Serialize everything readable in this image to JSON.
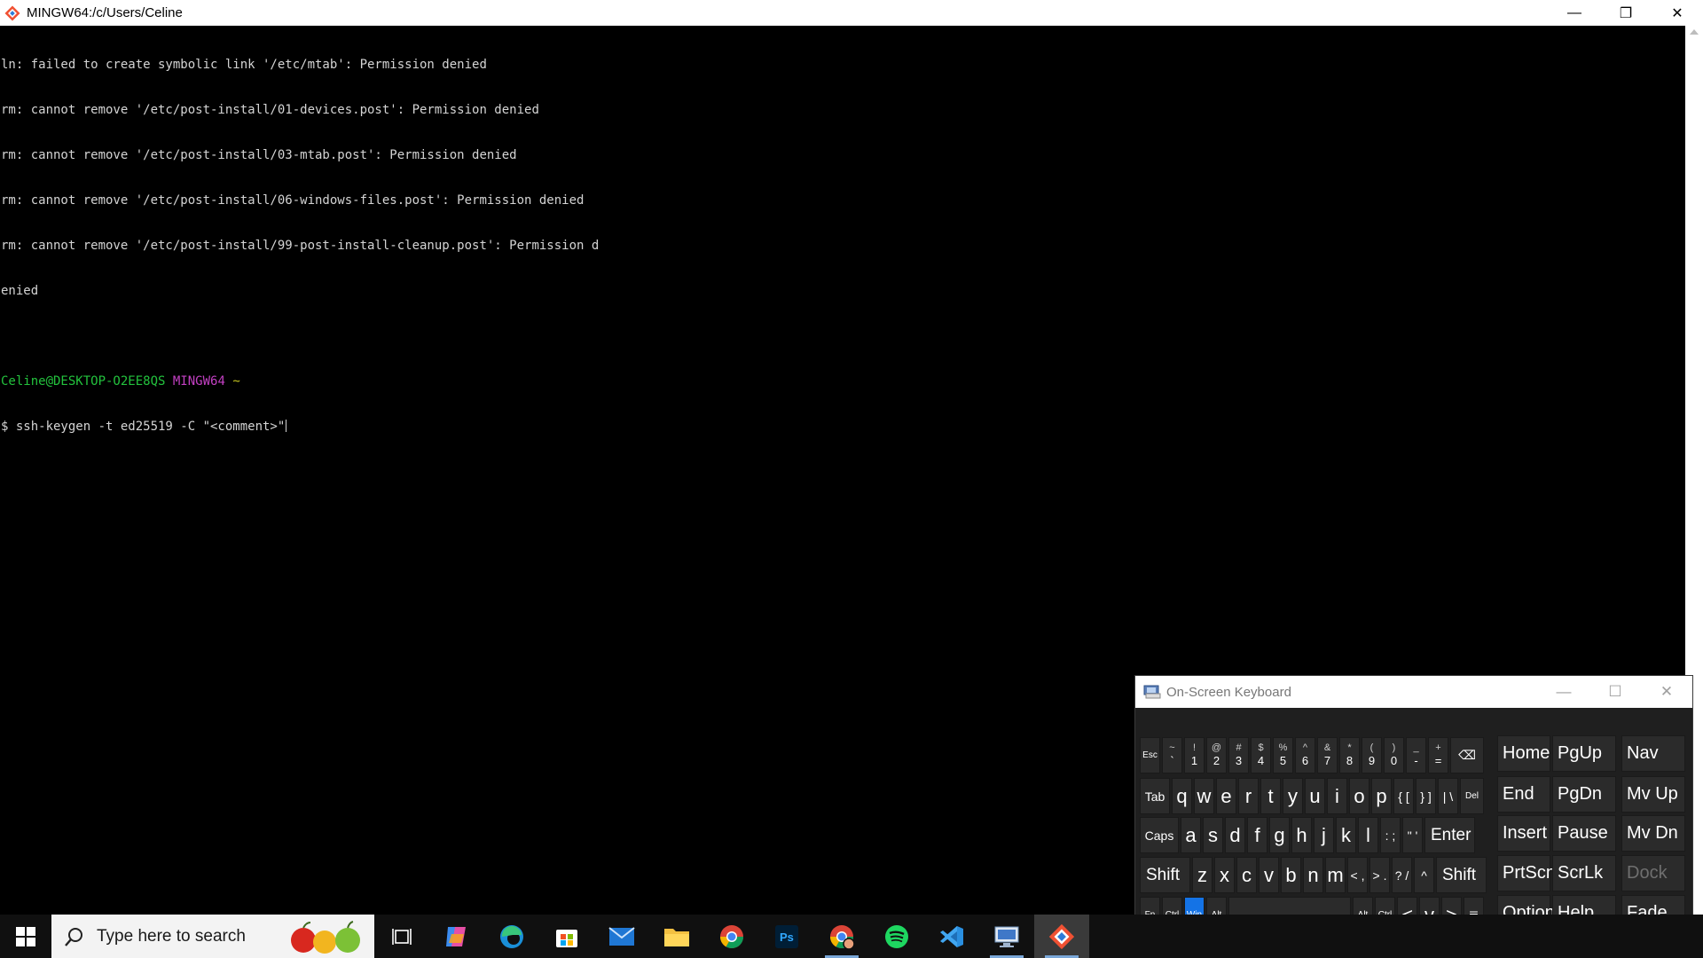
{
  "window": {
    "title": "MINGW64:/c/Users/Celine",
    "minimize_glyph": "—",
    "restore_glyph": "❐",
    "close_glyph": "✕"
  },
  "terminal": {
    "lines": [
      "ln: failed to create symbolic link '/etc/mtab': Permission denied",
      "rm: cannot remove '/etc/post-install/01-devices.post': Permission denied",
      "rm: cannot remove '/etc/post-install/03-mtab.post': Permission denied",
      "rm: cannot remove '/etc/post-install/06-windows-files.post': Permission denied",
      "rm: cannot remove '/etc/post-install/99-post-install-cleanup.post': Permission d",
      "enied",
      ""
    ],
    "prompt": {
      "user_host": "Celine@DESKTOP-O2EE8QS",
      "system": "MINGW64",
      "dir": "~"
    },
    "command_line": "$ ssh-keygen -t ed25519 -C \"<comment>\""
  },
  "osk": {
    "title": "On-Screen Keyboard",
    "row1": [
      {
        "lo": "Esc",
        "type": "tiny"
      },
      {
        "hi": "~",
        "lo": "`"
      },
      {
        "hi": "!",
        "lo": "1"
      },
      {
        "hi": "@",
        "lo": "2"
      },
      {
        "hi": "#",
        "lo": "3"
      },
      {
        "hi": "$",
        "lo": "4"
      },
      {
        "hi": "%",
        "lo": "5"
      },
      {
        "hi": "^",
        "lo": "6"
      },
      {
        "hi": "&",
        "lo": "7"
      },
      {
        "hi": "*",
        "lo": "8"
      },
      {
        "hi": "(",
        "lo": "9"
      },
      {
        "hi": ")",
        "lo": "0"
      },
      {
        "hi": "_",
        "lo": "-"
      },
      {
        "hi": "+",
        "lo": "="
      },
      {
        "lo": "⌫",
        "type": "small"
      }
    ],
    "row2": [
      "Tab",
      "q",
      "w",
      "e",
      "r",
      "t",
      "y",
      "u",
      "i",
      "o",
      "p",
      "{ [",
      "} ]",
      "| \\",
      "Del"
    ],
    "row3": [
      "Caps",
      "a",
      "s",
      "d",
      "f",
      "g",
      "h",
      "j",
      "k",
      "l",
      ": ;",
      "\" '",
      "Enter"
    ],
    "row4": [
      "Shift",
      "z",
      "x",
      "c",
      "v",
      "b",
      "n",
      "m",
      "< ,",
      "> .",
      "? /",
      "^",
      "Shift"
    ],
    "row5": [
      "Fn",
      "Ctrl",
      "Win",
      "Alt",
      "",
      "Alt",
      "Ctrl",
      "<",
      "v",
      ">",
      "≣"
    ],
    "nav": [
      [
        "Home",
        "PgUp",
        "Nav"
      ],
      [
        "End",
        "PgDn",
        "Mv Up"
      ],
      [
        "Insert",
        "Pause",
        "Mv Dn"
      ],
      [
        "PrtScn",
        "ScrLk",
        "Dock"
      ],
      [
        "Options",
        "Help",
        "Fade"
      ]
    ]
  },
  "taskbar": {
    "search_placeholder": "Type here to search",
    "apps": [
      "task-view",
      "copilot",
      "edge",
      "store",
      "mail",
      "file-explorer",
      "chrome",
      "photoshop",
      "chrome-profile",
      "spotify",
      "vscode",
      "remote-desktop",
      "git-bash"
    ]
  }
}
